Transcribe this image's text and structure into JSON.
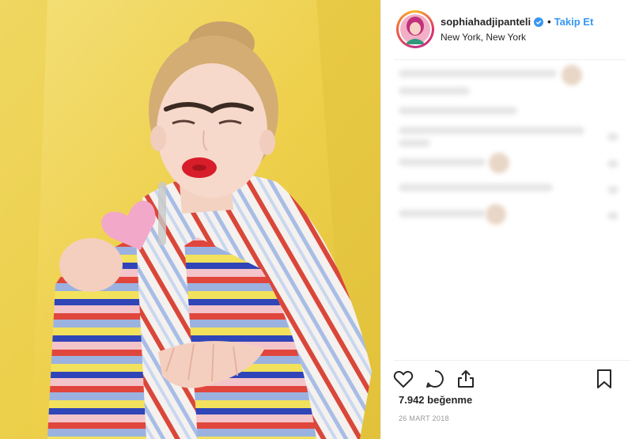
{
  "post": {
    "image_alt": "Photo of a woman with red lipstick blowing a kiss, holding a pink heart-shaped cookie, wearing a striped knit sweater against a yellow backdrop",
    "username": "sophiahadjipanteli",
    "verified": true,
    "separator": "•",
    "follow_label": "Takip Et",
    "location": "New York, New York",
    "likes_text": "7.942 beğenme",
    "date": "26 MART 2018"
  },
  "icons": [
    "heart-icon",
    "comment-icon",
    "share-icon",
    "bookmark-icon",
    "verified-badge-icon"
  ],
  "colors": {
    "accent": "#3897f0",
    "text": "#262626",
    "muted": "#999999",
    "background": "#f0d44e"
  }
}
